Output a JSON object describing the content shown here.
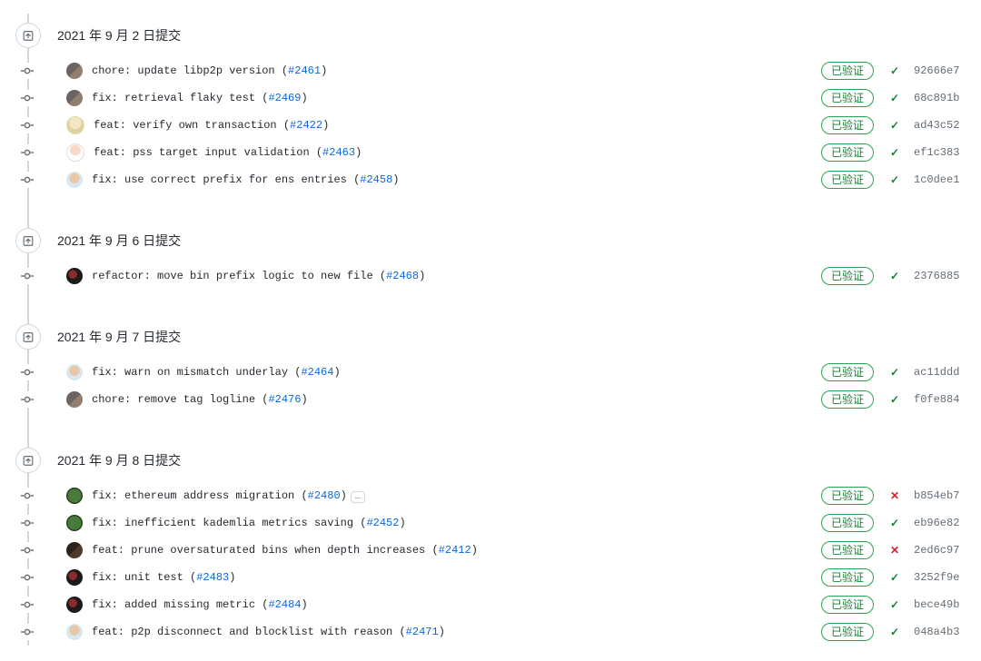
{
  "verified_label": "已验证",
  "groups": [
    {
      "date": "2021 年 9 月 2 日提交",
      "commits": [
        {
          "avatar": "avatar-a",
          "msg": "chore: update libp2p version",
          "pr": "#2461",
          "ellipsis": false,
          "status": "pass",
          "sha": "92666e7"
        },
        {
          "avatar": "avatar-a",
          "msg": "fix: retrieval flaky test",
          "pr": "#2469",
          "ellipsis": false,
          "status": "pass",
          "sha": "68c891b"
        },
        {
          "avatar": "avatar-b",
          "msg": "feat: verify own transaction",
          "pr": "#2422",
          "ellipsis": false,
          "status": "pass",
          "sha": "ad43c52"
        },
        {
          "avatar": "avatar-c",
          "msg": "feat: pss target input validation",
          "pr": "#2463",
          "ellipsis": false,
          "status": "pass",
          "sha": "ef1c383"
        },
        {
          "avatar": "avatar-d",
          "msg": "fix: use correct prefix for ens entries",
          "pr": "#2458",
          "ellipsis": false,
          "status": "pass",
          "sha": "1c0dee1"
        }
      ]
    },
    {
      "date": "2021 年 9 月 6 日提交",
      "commits": [
        {
          "avatar": "avatar-e",
          "msg": "refactor: move bin prefix logic to new file",
          "pr": "#2468",
          "ellipsis": false,
          "status": "pass",
          "sha": "2376885"
        }
      ]
    },
    {
      "date": "2021 年 9 月 7 日提交",
      "commits": [
        {
          "avatar": "avatar-d",
          "msg": "fix: warn on mismatch underlay",
          "pr": "#2464",
          "ellipsis": false,
          "status": "pass",
          "sha": "ac11ddd"
        },
        {
          "avatar": "avatar-a",
          "msg": "chore: remove tag logline",
          "pr": "#2476",
          "ellipsis": false,
          "status": "pass",
          "sha": "f0fe884"
        }
      ]
    },
    {
      "date": "2021 年 9 月 8 日提交",
      "commits": [
        {
          "avatar": "avatar-f",
          "msg": "fix: ethereum address migration",
          "pr": "#2480",
          "ellipsis": true,
          "status": "fail",
          "sha": "b854eb7"
        },
        {
          "avatar": "avatar-f",
          "msg": "fix: inefficient kademlia metrics saving",
          "pr": "#2452",
          "ellipsis": false,
          "status": "pass",
          "sha": "eb96e82"
        },
        {
          "avatar": "avatar-g",
          "msg": "feat: prune oversaturated bins when depth increases",
          "pr": "#2412",
          "ellipsis": false,
          "status": "fail",
          "sha": "2ed6c97"
        },
        {
          "avatar": "avatar-e",
          "msg": "fix: unit test",
          "pr": "#2483",
          "ellipsis": false,
          "status": "pass",
          "sha": "3252f9e"
        },
        {
          "avatar": "avatar-e",
          "msg": "fix: added missing metric",
          "pr": "#2484",
          "ellipsis": false,
          "status": "pass",
          "sha": "bece49b"
        },
        {
          "avatar": "avatar-d",
          "msg": "feat: p2p disconnect and blocklist with reason",
          "pr": "#2471",
          "ellipsis": false,
          "status": "pass",
          "sha": "048a4b3"
        }
      ]
    }
  ]
}
